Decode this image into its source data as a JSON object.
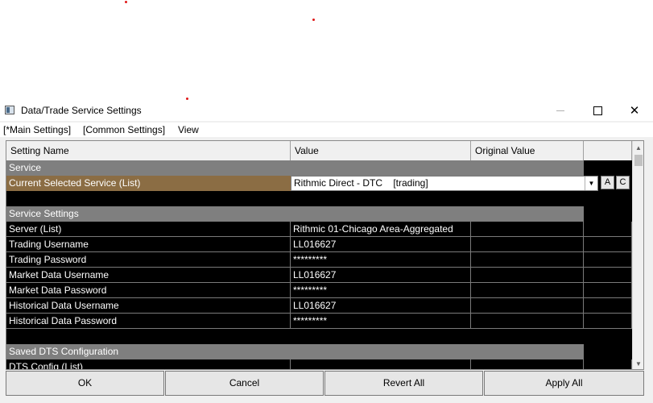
{
  "window": {
    "title": "Data/Trade Service Settings"
  },
  "menu": [
    "[*Main Settings]",
    "[Common Settings]",
    "View"
  ],
  "grid": {
    "columns": [
      "Setting Name",
      "Value",
      "Original Value",
      ""
    ],
    "service_section": "Service",
    "current_service": {
      "name": "Current Selected Service (List)",
      "value": "Rithmic Direct - DTC    [trading]",
      "btn_a": "A",
      "btn_c": "C"
    },
    "service_settings_section": "Service Settings",
    "settings": [
      {
        "name": "Server (List)",
        "value": "Rithmic 01-Chicago Area-Aggregated"
      },
      {
        "name": "Trading Username",
        "value": "LL016627"
      },
      {
        "name": "Trading Password",
        "value": "*********"
      },
      {
        "name": "Market Data Username",
        "value": "LL016627"
      },
      {
        "name": "Market Data Password",
        "value": "*********"
      },
      {
        "name": "Historical Data Username",
        "value": "LL016627"
      },
      {
        "name": "Historical Data Password",
        "value": "*********"
      }
    ],
    "saved_section": "Saved DTS Configuration",
    "dts_config": "DTS Config (List)"
  },
  "buttons": {
    "ok": "OK",
    "cancel": "Cancel",
    "revert_all": "Revert All",
    "apply_all": "Apply All"
  },
  "colors": {
    "selected_row": "#8b6d44",
    "section_header": "#7f7f7f",
    "grid_background": "#000000"
  }
}
